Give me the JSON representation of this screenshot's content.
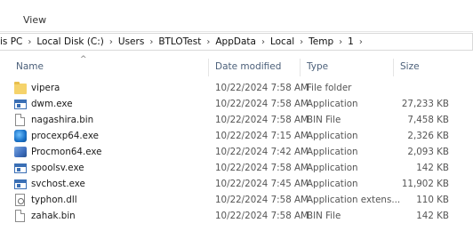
{
  "ribbon": {
    "view_tab": "View"
  },
  "address": {
    "crumbs": [
      "is PC",
      "Local Disk (C:)",
      "Users",
      "BTLOTest",
      "AppData",
      "Local",
      "Temp",
      "1"
    ]
  },
  "columns": {
    "name": "Name",
    "date_modified": "Date modified",
    "type": "Type",
    "size": "Size"
  },
  "files": [
    {
      "icon": "folder-icon",
      "name": "vipera",
      "date": "10/22/2024 7:58 AM",
      "type": "File folder",
      "size": ""
    },
    {
      "icon": "application-icon",
      "name": "dwm.exe",
      "date": "10/22/2024 7:58 AM",
      "type": "Application",
      "size": "27,233 KB"
    },
    {
      "icon": "file-icon",
      "name": "nagashira.bin",
      "date": "10/22/2024 7:58 AM",
      "type": "BIN File",
      "size": "7,458 KB"
    },
    {
      "icon": "process-explorer-icon",
      "name": "procexp64.exe",
      "date": "10/22/2024 7:15 AM",
      "type": "Application",
      "size": "2,326 KB"
    },
    {
      "icon": "process-monitor-icon",
      "name": "Procmon64.exe",
      "date": "10/22/2024 7:42 AM",
      "type": "Application",
      "size": "2,093 KB"
    },
    {
      "icon": "application-icon",
      "name": "spoolsv.exe",
      "date": "10/22/2024 7:58 AM",
      "type": "Application",
      "size": "142 KB"
    },
    {
      "icon": "application-icon",
      "name": "svchost.exe",
      "date": "10/22/2024 7:45 AM",
      "type": "Application",
      "size": "11,902 KB"
    },
    {
      "icon": "dll-icon",
      "name": "typhon.dll",
      "date": "10/22/2024 7:58 AM",
      "type": "Application extens...",
      "size": "110 KB"
    },
    {
      "icon": "file-icon",
      "name": "zahak.bin",
      "date": "10/22/2024 7:58 AM",
      "type": "BIN File",
      "size": "142 KB"
    }
  ]
}
